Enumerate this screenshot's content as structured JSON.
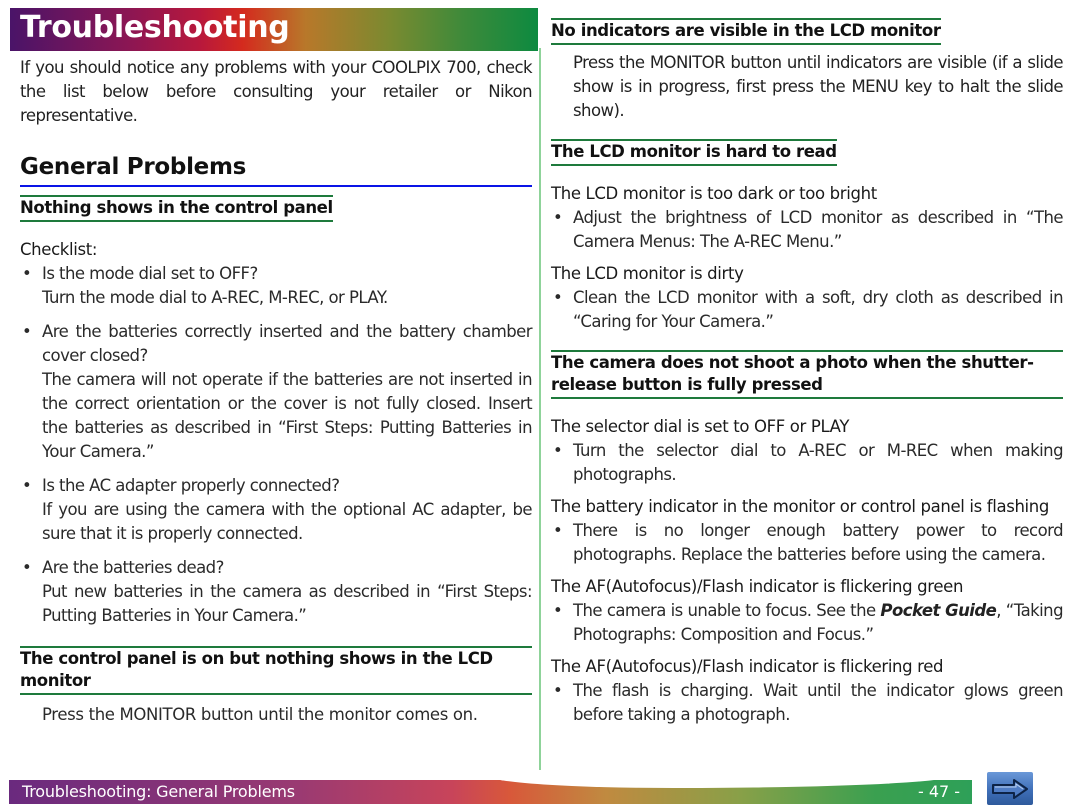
{
  "header": {
    "title": "Troubleshooting"
  },
  "intro": "If you should notice any problems with your COOLPIX 700, check the list below before consulting your retailer or Nikon representative.",
  "section_title": "General Problems",
  "left": {
    "s1": {
      "heading": "Nothing shows in the control panel",
      "label": "Checklist:",
      "items": [
        {
          "q": "Is the mode dial set to OFF?",
          "a": "Turn the mode dial to A-REC, M-REC, or PLAY."
        },
        {
          "q": "Are the batteries correctly inserted and the battery chamber cover closed?",
          "a": "The camera will not operate if the batteries are not inserted in the correct orientation or the cover is not fully closed. Insert the batteries as described in “First Steps: Putting Batteries in Your Camera.”"
        },
        {
          "q": "Is the AC adapter properly connected?",
          "a": "If you are using the camera with the optional AC adapter, be sure that it is properly connected."
        },
        {
          "q": "Are the batteries dead?",
          "a": "Put new batteries in the camera as described in “First Steps: Putting Batteries in Your Camera.”"
        }
      ]
    },
    "s2": {
      "heading": "The control panel is on but nothing shows in the LCD monitor",
      "text": "Press the MONITOR button until the monitor comes on."
    }
  },
  "right": {
    "s3": {
      "heading": "No indicators are visible in the LCD monitor",
      "text": "Press the MONITOR button until indicators are visible (if a slide show is in progress, first press the MENU key to halt the slide show)."
    },
    "s4": {
      "heading": "The LCD monitor is hard to read",
      "cases": [
        {
          "title": "The LCD monitor is too dark or too bright",
          "bullet": "Adjust the brightness of LCD monitor as described in “The Camera Menus: The A-REC Menu.”"
        },
        {
          "title": "The LCD monitor is dirty",
          "bullet": "Clean the LCD monitor with a soft, dry cloth as described in “Caring for Your Camera.”"
        }
      ]
    },
    "s5": {
      "heading": "The camera does not shoot a photo when the shutter-release button is fully pressed",
      "cases": [
        {
          "title": "The selector dial is set to OFF or PLAY",
          "bullet": "Turn the selector dial to A-REC or M-REC when making photographs."
        },
        {
          "title": "The battery indicator in the monitor or control panel is flashing",
          "bullet": "There is no longer enough battery power to record photographs.  Replace the batteries before using the camera."
        },
        {
          "title": "The AF(Autofocus)/Flash indicator is flickering green",
          "bullet_pre": "The camera is unable to focus.  See the ",
          "bullet_em": "Pocket Guide",
          "bullet_post": ", “Taking Photographs: Composition and Focus.”"
        },
        {
          "title": "The AF(Autofocus)/Flash indicator is flickering red",
          "bullet": "The flash is charging.  Wait until the indicator glows green before taking a photograph."
        }
      ]
    }
  },
  "footer": {
    "breadcrumb": "Troubleshooting: General Problems",
    "page": "- 47 -",
    "next_icon": "right-arrow-icon"
  },
  "colors": {
    "heading_rule": "#1e7a3c",
    "section_rule": "#0a14e6",
    "divider": "#8fd39a",
    "nav_button": "#3f6fb8"
  }
}
